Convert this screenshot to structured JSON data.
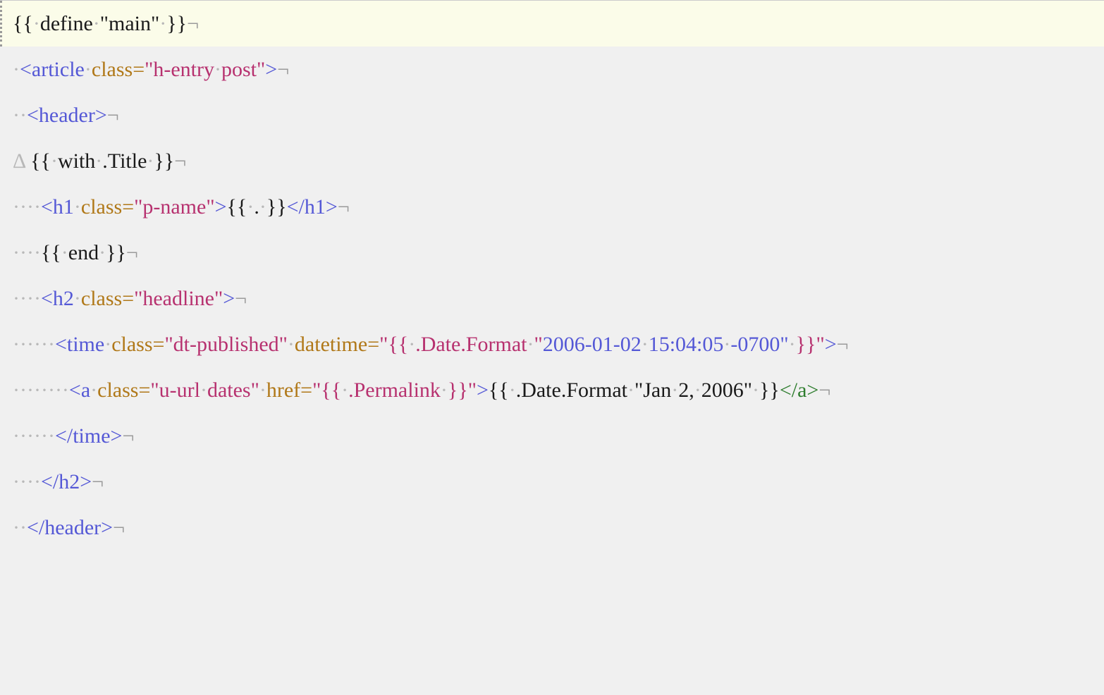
{
  "lines": [
    {
      "highlighted": true,
      "segments": [
        {
          "cls": "text",
          "txt": "{{"
        },
        {
          "cls": "ws",
          "txt": "·"
        },
        {
          "cls": "text",
          "txt": "define"
        },
        {
          "cls": "ws",
          "txt": "·"
        },
        {
          "cls": "text",
          "txt": "\"main\""
        },
        {
          "cls": "ws",
          "txt": "·"
        },
        {
          "cls": "text",
          "txt": "}}"
        },
        {
          "cls": "endmark",
          "txt": "¬"
        }
      ]
    },
    {
      "segments": [
        {
          "cls": "ws",
          "txt": "·"
        },
        {
          "cls": "tag",
          "txt": "<article"
        },
        {
          "cls": "ws",
          "txt": "·"
        },
        {
          "cls": "attr",
          "txt": "class="
        },
        {
          "cls": "string",
          "txt": "\"h-entry"
        },
        {
          "cls": "ws",
          "txt": "·"
        },
        {
          "cls": "string",
          "txt": "post\""
        },
        {
          "cls": "tag",
          "txt": ">"
        },
        {
          "cls": "endmark",
          "txt": "¬"
        }
      ]
    },
    {
      "segments": [
        {
          "cls": "ws",
          "txt": "··"
        },
        {
          "cls": "tag",
          "txt": "<header>"
        },
        {
          "cls": "endmark",
          "txt": "¬"
        }
      ]
    },
    {
      "segments": [
        {
          "cls": "ws",
          "txt": "Δ "
        },
        {
          "cls": "text",
          "txt": "{{"
        },
        {
          "cls": "ws",
          "txt": "·"
        },
        {
          "cls": "text",
          "txt": "with"
        },
        {
          "cls": "ws",
          "txt": "·"
        },
        {
          "cls": "text",
          "txt": ".Title"
        },
        {
          "cls": "ws",
          "txt": "·"
        },
        {
          "cls": "text",
          "txt": "}}"
        },
        {
          "cls": "endmark",
          "txt": "¬"
        }
      ]
    },
    {
      "segments": [
        {
          "cls": "ws",
          "txt": "····"
        },
        {
          "cls": "tag",
          "txt": "<h1"
        },
        {
          "cls": "ws",
          "txt": "·"
        },
        {
          "cls": "attr",
          "txt": "class="
        },
        {
          "cls": "string",
          "txt": "\"p-name\""
        },
        {
          "cls": "tag",
          "txt": ">"
        },
        {
          "cls": "text",
          "txt": "{{"
        },
        {
          "cls": "ws",
          "txt": "·"
        },
        {
          "cls": "text",
          "txt": "."
        },
        {
          "cls": "ws",
          "txt": "·"
        },
        {
          "cls": "text",
          "txt": "}}"
        },
        {
          "cls": "tag",
          "txt": "</h1>"
        },
        {
          "cls": "endmark",
          "txt": "¬"
        }
      ]
    },
    {
      "segments": [
        {
          "cls": "ws",
          "txt": "····"
        },
        {
          "cls": "text",
          "txt": "{{"
        },
        {
          "cls": "ws",
          "txt": "·"
        },
        {
          "cls": "text",
          "txt": "end"
        },
        {
          "cls": "ws",
          "txt": "·"
        },
        {
          "cls": "text",
          "txt": "}}"
        },
        {
          "cls": "endmark",
          "txt": "¬"
        }
      ]
    },
    {
      "segments": [
        {
          "cls": "ws",
          "txt": "····"
        },
        {
          "cls": "tag",
          "txt": "<h2"
        },
        {
          "cls": "ws",
          "txt": "·"
        },
        {
          "cls": "attr",
          "txt": "class="
        },
        {
          "cls": "string",
          "txt": "\"headline\""
        },
        {
          "cls": "tag",
          "txt": ">"
        },
        {
          "cls": "endmark",
          "txt": "¬"
        }
      ]
    },
    {
      "segments": [
        {
          "cls": "ws",
          "txt": "······"
        },
        {
          "cls": "tag",
          "txt": "<time"
        },
        {
          "cls": "ws",
          "txt": "·"
        },
        {
          "cls": "attr",
          "txt": "class="
        },
        {
          "cls": "string",
          "txt": "\"dt-published\""
        },
        {
          "cls": "ws",
          "txt": "·"
        },
        {
          "cls": "attr",
          "txt": "datetime="
        },
        {
          "cls": "string",
          "txt": "\"{{"
        },
        {
          "cls": "ws",
          "txt": "·"
        },
        {
          "cls": "string",
          "txt": ".Date.Format"
        },
        {
          "cls": "ws",
          "txt": "·"
        },
        {
          "cls": "string",
          "txt": "\""
        },
        {
          "cls": "tag",
          "txt": "2006-01-02"
        },
        {
          "cls": "ws",
          "txt": "·"
        },
        {
          "cls": "tag",
          "txt": "15:04:05"
        },
        {
          "cls": "ws",
          "txt": "·"
        },
        {
          "cls": "tag",
          "txt": "-0700\""
        },
        {
          "cls": "ws",
          "txt": "·"
        },
        {
          "cls": "string",
          "txt": "}}\""
        },
        {
          "cls": "tag",
          "txt": ">"
        },
        {
          "cls": "endmark",
          "txt": "¬"
        }
      ]
    },
    {
      "segments": [
        {
          "cls": "ws",
          "txt": "········"
        },
        {
          "cls": "tag",
          "txt": "<a"
        },
        {
          "cls": "ws",
          "txt": "·"
        },
        {
          "cls": "attr",
          "txt": "class="
        },
        {
          "cls": "string",
          "txt": "\"u-url"
        },
        {
          "cls": "ws",
          "txt": "·"
        },
        {
          "cls": "string",
          "txt": "dates\""
        },
        {
          "cls": "ws",
          "txt": "·"
        },
        {
          "cls": "attr",
          "txt": "href="
        },
        {
          "cls": "string",
          "txt": "\"{{"
        },
        {
          "cls": "ws",
          "txt": "·"
        },
        {
          "cls": "string",
          "txt": ".Permalink"
        },
        {
          "cls": "ws",
          "txt": "·"
        },
        {
          "cls": "string",
          "txt": "}}\""
        },
        {
          "cls": "tag",
          "txt": ">"
        },
        {
          "cls": "text",
          "txt": "{{"
        },
        {
          "cls": "ws",
          "txt": "·"
        },
        {
          "cls": "text",
          "txt": ".Date.Format"
        },
        {
          "cls": "ws",
          "txt": "·"
        },
        {
          "cls": "text",
          "txt": "\"Jan"
        },
        {
          "cls": "ws",
          "txt": "·"
        },
        {
          "cls": "text",
          "txt": "2,"
        },
        {
          "cls": "ws",
          "txt": "·"
        },
        {
          "cls": "text",
          "txt": "2006\""
        },
        {
          "cls": "ws",
          "txt": "·"
        },
        {
          "cls": "text",
          "txt": "}}"
        },
        {
          "cls": "closetag",
          "txt": "</a>"
        },
        {
          "cls": "endmark",
          "txt": "¬"
        }
      ]
    },
    {
      "segments": [
        {
          "cls": "ws",
          "txt": "······"
        },
        {
          "cls": "tag",
          "txt": "</time>"
        },
        {
          "cls": "endmark",
          "txt": "¬"
        }
      ]
    },
    {
      "segments": [
        {
          "cls": "ws",
          "txt": "····"
        },
        {
          "cls": "tag",
          "txt": "</h2>"
        },
        {
          "cls": "endmark",
          "txt": "¬"
        }
      ]
    },
    {
      "segments": [
        {
          "cls": "ws",
          "txt": "··"
        },
        {
          "cls": "tag",
          "txt": "</header>"
        },
        {
          "cls": "endmark",
          "txt": "¬"
        }
      ]
    }
  ]
}
